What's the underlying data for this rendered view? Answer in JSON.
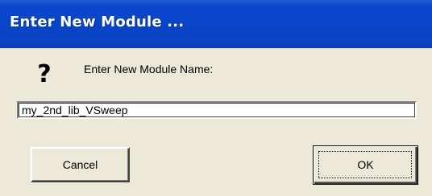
{
  "dialog": {
    "title": "Enter New Module ...",
    "icon": "question-icon",
    "icon_glyph": "?",
    "prompt": "Enter New Module Name:",
    "input_value": "my_2nd_lib_VSweep",
    "cancel_label": "Cancel",
    "ok_label": "OK"
  },
  "colors": {
    "titlebar": "#0845c8",
    "dialog_background": "#ece9d8",
    "title_text": "#ffffff"
  }
}
